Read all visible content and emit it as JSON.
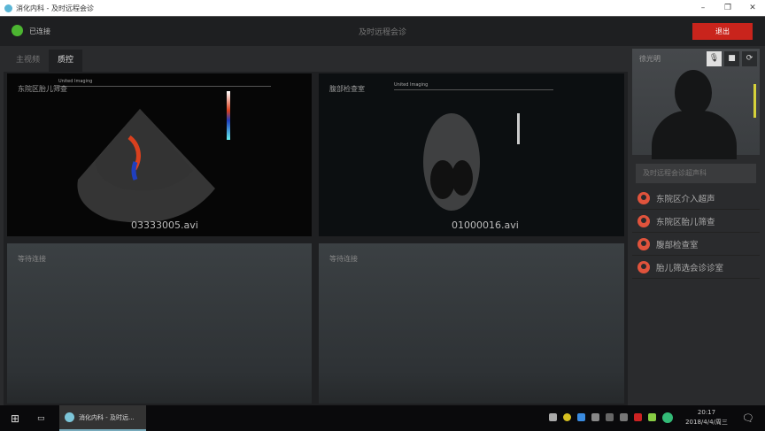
{
  "window": {
    "title": "消化内科 - 及时远程会诊",
    "minimize": "–",
    "maximize": "❐",
    "close": "✕"
  },
  "header": {
    "status": "已连接",
    "title": "及时远程会诊",
    "exit_label": "退出",
    "status_color": "#4cb531",
    "exit_color": "#c9241c"
  },
  "tabs": [
    {
      "label": "主视频"
    },
    {
      "label": "质控"
    }
  ],
  "panels": [
    {
      "label": "东院区胎儿筛查",
      "file": "03333005.avi",
      "brand": "United Imaging"
    },
    {
      "label": "腹部检查室",
      "file": "01000016.avi",
      "brand": "United Imaging"
    },
    {
      "label": "等待连接"
    },
    {
      "label": "等待连接"
    }
  ],
  "sidebar": {
    "camera_name": "徐光明",
    "search_placeholder": "及时远程会诊超声科",
    "rooms": [
      {
        "label": "东院区介入超声"
      },
      {
        "label": "东院区胎儿筛查"
      },
      {
        "label": "腹部检查室"
      },
      {
        "label": "胎儿筛选会诊诊室"
      }
    ]
  },
  "taskbar": {
    "app_label": "消化内科 - 及时远...",
    "time": "20:17",
    "date": "2018/4/4/周三"
  }
}
